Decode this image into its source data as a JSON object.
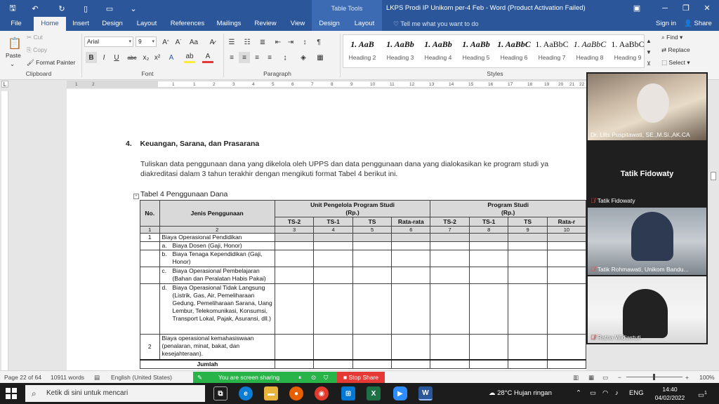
{
  "titlebar": {
    "table_tools": "Table Tools",
    "title": "LKPS Prodi IP Unikom per-4 Feb  -  Word (Product Activation Failed)",
    "icons": [
      "save-icon",
      "undo-icon",
      "redo-icon",
      "new-doc-icon",
      "open-folder-icon",
      "more-icon"
    ]
  },
  "tabs": [
    "File",
    "Home",
    "Insert",
    "Design",
    "Layout",
    "References",
    "Mailings",
    "Review",
    "View",
    "Design",
    "Layout"
  ],
  "tellme": "Tell me what you want to do",
  "signin": "Sign in",
  "share": "Share",
  "clipboard": {
    "paste": "Paste",
    "cut": "Cut",
    "copy": "Copy",
    "format_painter": "Format Painter",
    "label": "Clipboard"
  },
  "font": {
    "name": "Arial",
    "size": "9",
    "label": "Font"
  },
  "paragraph": {
    "label": "Paragraph"
  },
  "styles": {
    "label": "Styles",
    "items": [
      {
        "sample": "1. AaB",
        "name": "Heading 2"
      },
      {
        "sample": "1. AaBb",
        "name": "Heading 3"
      },
      {
        "sample": "1. AaBb",
        "name": "Heading 4"
      },
      {
        "sample": "1. AaBb",
        "name": "Heading 5"
      },
      {
        "sample": "1. AaBbC",
        "name": "Heading 6"
      },
      {
        "sample": "1. AaBbC",
        "name": "Heading 7"
      },
      {
        "sample": "1. AaBbC",
        "name": "Heading 8"
      },
      {
        "sample": "1. AaBbC",
        "name": "Heading 9"
      }
    ]
  },
  "editing": {
    "find": "Find",
    "replace": "Replace",
    "select": "Select"
  },
  "ruler_ticks": [
    "1",
    "2",
    "1",
    "1",
    "2",
    "3",
    "4",
    "5",
    "6",
    "7",
    "8",
    "9",
    "10",
    "11",
    "12",
    "13",
    "14",
    "15",
    "16",
    "17",
    "18",
    "19",
    "20",
    "21",
    "22"
  ],
  "document": {
    "heading_num": "4.",
    "heading": "Keuangan, Sarana, dan Prasarana",
    "para_line1": "Tuliskan data penggunaan dana yang dikelola oleh UPPS dan data penggunaan dana yang dialokasikan ke program studi ya",
    "para_line2": "diakreditasi dalam 3 tahun terakhir dengan mengikuti format Tabel 4 berikut ini.",
    "caption": "Tabel 4 Penggunaan Dana",
    "table": {
      "col_no": "No.",
      "col_jenis": "Jenis Penggunaan",
      "group_upps_line1": "Unit Pengelola Program Studi",
      "group_upps_line2": "(Rp.)",
      "group_ps_line1": "Program Studi",
      "group_ps_line2": "(Rp.)",
      "sub_cols": [
        "TS-2",
        "TS-1",
        "TS",
        "Rata-rata",
        "TS-2",
        "TS-1",
        "TS",
        "Rata-r"
      ],
      "index_row": [
        "1",
        "2",
        "3",
        "4",
        "5",
        "6",
        "7",
        "8",
        "9",
        "10"
      ],
      "rows": [
        {
          "no": "1",
          "text": "Biaya Operasional Pendidikan"
        },
        {
          "letter": "a.",
          "text": "Biaya Dosen (Gaji, Honor)"
        },
        {
          "letter": "b.",
          "text": "Biaya Tenaga Kependidikan (Gaji, Honor)"
        },
        {
          "letter": "c.",
          "text": "Biaya Operasional Pembelajaran (Bahan dan Peralatan Habis Pakai)"
        },
        {
          "letter": "d.",
          "text": "Biaya Operasional Tidak Langsung (Listrik, Gas, Air, Pemeliharaan Gedung, Pemeliharaan Sarana, Uang Lembur, Telekomunikasi, Konsumsi, Transport Lokal, Pajak, Asuransi, dll.)"
        },
        {
          "no": "2",
          "text": "Biaya operasional kemahasiswaan (penalaran, minat, bakat, dan kesejahteraan)."
        }
      ],
      "total_label": "Jumlah"
    }
  },
  "participants": [
    {
      "name": "Dr. Lilis Puspitawati, SE.,M.Si.,AK.CA",
      "muted": false
    },
    {
      "name": "Tatik Fidowaty",
      "big_name": "Tatik Fidowaty",
      "muted": true
    },
    {
      "name": "Tatik Rohmawati, Unikom Bandu...",
      "muted": true
    },
    {
      "name": "Ratna Widiastuti",
      "muted": true
    }
  ],
  "statusbar": {
    "page": "Page 22 of 64",
    "words": "10911 words",
    "language": "English (United States)",
    "sharing": "You are screen sharing",
    "stop_share": "Stop Share",
    "zoom": "100%"
  },
  "taskbar": {
    "search_placeholder": "Ketik di sini untuk mencari",
    "weather": "28°C  Hujan ringan",
    "lang": "ENG",
    "time": "14:40",
    "date": "04/02/2022",
    "notif_count": "1"
  }
}
